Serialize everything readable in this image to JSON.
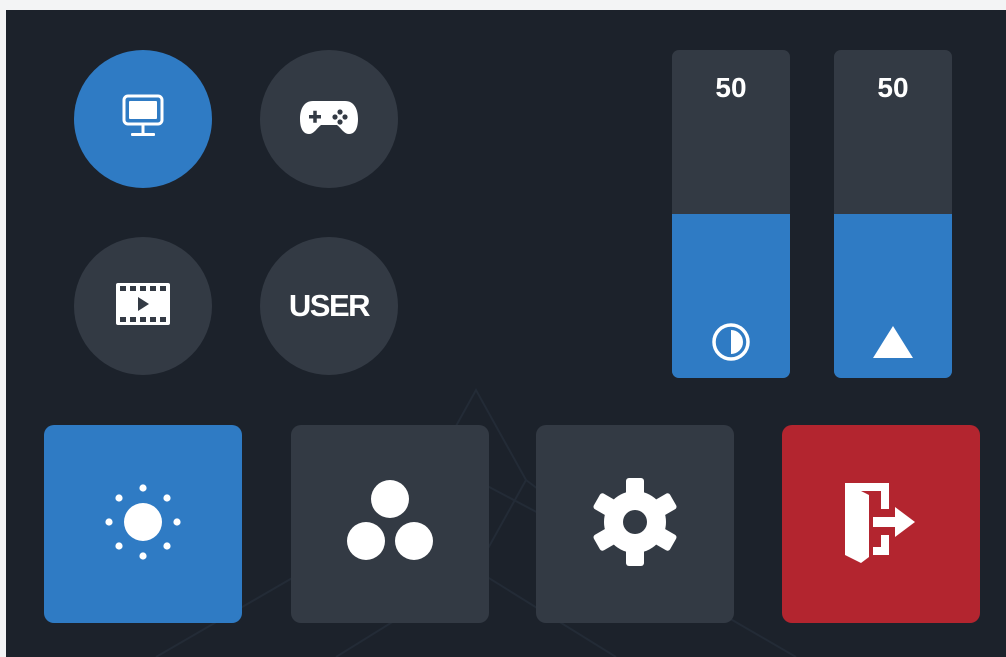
{
  "modes": [
    {
      "icon": "monitor-icon",
      "active": true
    },
    {
      "icon": "gamepad-icon",
      "active": false
    },
    {
      "icon": "film-icon",
      "active": false
    },
    {
      "label": "USER",
      "active": false
    }
  ],
  "sliders": {
    "contrast": {
      "value": "50",
      "level": 0.5,
      "icon": "contrast-icon"
    },
    "sharpness": {
      "value": "50",
      "level": 0.5,
      "icon": "triangle-icon"
    }
  },
  "tiles": [
    {
      "icon": "brightness-icon",
      "color": "#2f7bc4"
    },
    {
      "icon": "color-dots-icon",
      "color": "#333a44"
    },
    {
      "icon": "gear-icon",
      "color": "#333a44"
    },
    {
      "icon": "exit-icon",
      "color": "#b3252f"
    }
  ],
  "colors": {
    "background": "#1c222b",
    "button": "#333a44",
    "accent": "#2f7bc4",
    "danger": "#b3252f"
  }
}
